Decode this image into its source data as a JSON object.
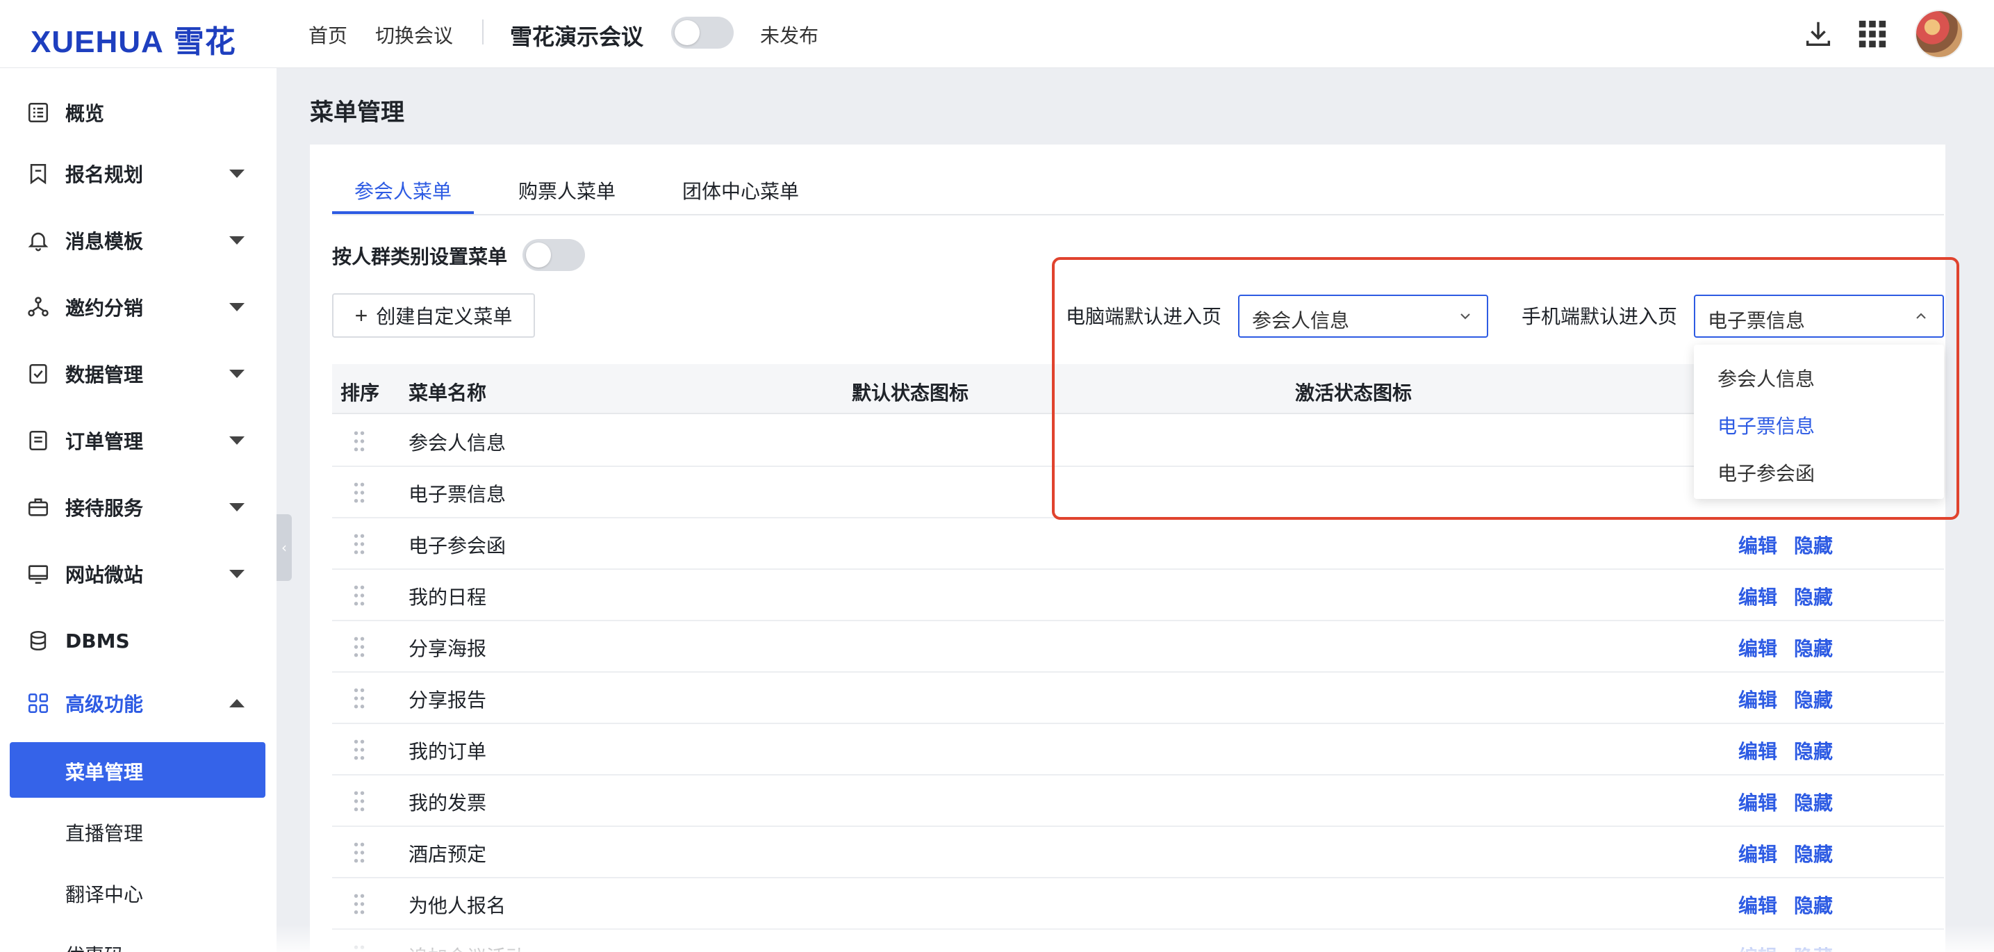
{
  "header": {
    "logo_text": "XUEHUA",
    "logo_cn": "雪花",
    "nav": [
      "首页",
      "切换会议"
    ],
    "conference_name": "雪花演示会议",
    "publish_status": "未发布"
  },
  "sidebar": {
    "items": [
      {
        "label": "概览",
        "icon": "overview-icon",
        "has_caret": false
      },
      {
        "label": "报名规划",
        "icon": "bookmark-icon",
        "has_caret": true
      },
      {
        "label": "消息模板",
        "icon": "bell-icon",
        "has_caret": true
      },
      {
        "label": "邀约分销",
        "icon": "share-network-icon",
        "has_caret": true
      },
      {
        "label": "数据管理",
        "icon": "clipboard-check-icon",
        "has_caret": true
      },
      {
        "label": "订单管理",
        "icon": "order-list-icon",
        "has_caret": true
      },
      {
        "label": "接待服务",
        "icon": "luggage-icon",
        "has_caret": true
      },
      {
        "label": "网站微站",
        "icon": "monitor-icon",
        "has_caret": true
      },
      {
        "label": "DBMS",
        "icon": "database-icon",
        "has_caret": false
      },
      {
        "label": "高级功能",
        "icon": "grid-apps-icon",
        "has_caret": true,
        "expanded": true
      }
    ],
    "sub_items": [
      "菜单管理",
      "直播管理",
      "翻译中心",
      "优惠码"
    ],
    "selected_sub": "菜单管理"
  },
  "page": {
    "title": "菜单管理",
    "tabs": [
      "参会人菜单",
      "购票人菜单",
      "团体中心菜单"
    ],
    "active_tab": "参会人菜单",
    "by_group_label": "按人群类别设置菜单",
    "create_button": "创建自定义菜单",
    "pc_default_label": "电脑端默认进入页",
    "pc_default_value": "参会人信息",
    "mobile_default_label": "手机端默认进入页",
    "mobile_default_value": "电子票信息",
    "dropdown_options": [
      "参会人信息",
      "电子票信息",
      "电子参会函"
    ],
    "dropdown_selected": "电子票信息"
  },
  "table": {
    "headers": [
      "排序",
      "菜单名称",
      "默认状态图标",
      "激活状态图标"
    ],
    "edit_label": "编辑",
    "hide_label": "隐藏",
    "rows": [
      {
        "name": "参会人信息",
        "actions": false
      },
      {
        "name": "电子票信息",
        "actions": false
      },
      {
        "name": "电子参会函",
        "actions": true
      },
      {
        "name": "我的日程",
        "actions": true
      },
      {
        "name": "分享海报",
        "actions": true
      },
      {
        "name": "分享报告",
        "actions": true
      },
      {
        "name": "我的订单",
        "actions": true
      },
      {
        "name": "我的发票",
        "actions": true
      },
      {
        "name": "酒店预定",
        "actions": true
      },
      {
        "name": "为他人报名",
        "actions": true
      },
      {
        "name": "追加会议活动",
        "actions": true
      }
    ]
  },
  "colors": {
    "accent": "#2d5be3",
    "highlight": "#e0432e",
    "selected_bg": "#3563e9"
  }
}
